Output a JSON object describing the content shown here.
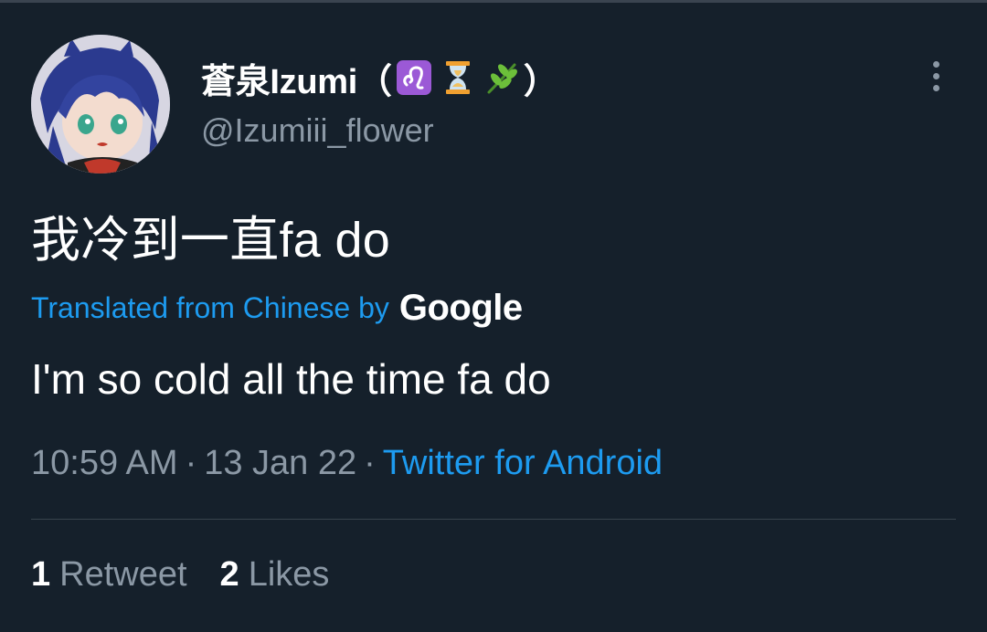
{
  "tweet": {
    "author": {
      "name": "蒼泉Izumi",
      "name_open": "（",
      "name_close": "）",
      "name_emojis": [
        "leo-sign",
        "hourglass",
        "herb"
      ],
      "handle": "@Izumiii_flower"
    },
    "text": "我冷到一直fa do",
    "translation_notice": {
      "prefix": "Translated from Chinese by",
      "brand": "Google"
    },
    "translation": "I'm so cold all the time fa do",
    "meta": {
      "time": "10:59 AM",
      "separator": "·",
      "date": "13 Jan 22",
      "source": "Twitter for Android"
    },
    "stats": {
      "retweets_count": "1",
      "retweets_label": "Retweet",
      "likes_count": "2",
      "likes_label": "Likes"
    }
  },
  "colors": {
    "background": "#15202b",
    "text": "#ffffff",
    "secondary_text": "#8b98a5",
    "link": "#1d9bf0",
    "divider": "#38444d",
    "leo_badge": "#9b59d6"
  }
}
